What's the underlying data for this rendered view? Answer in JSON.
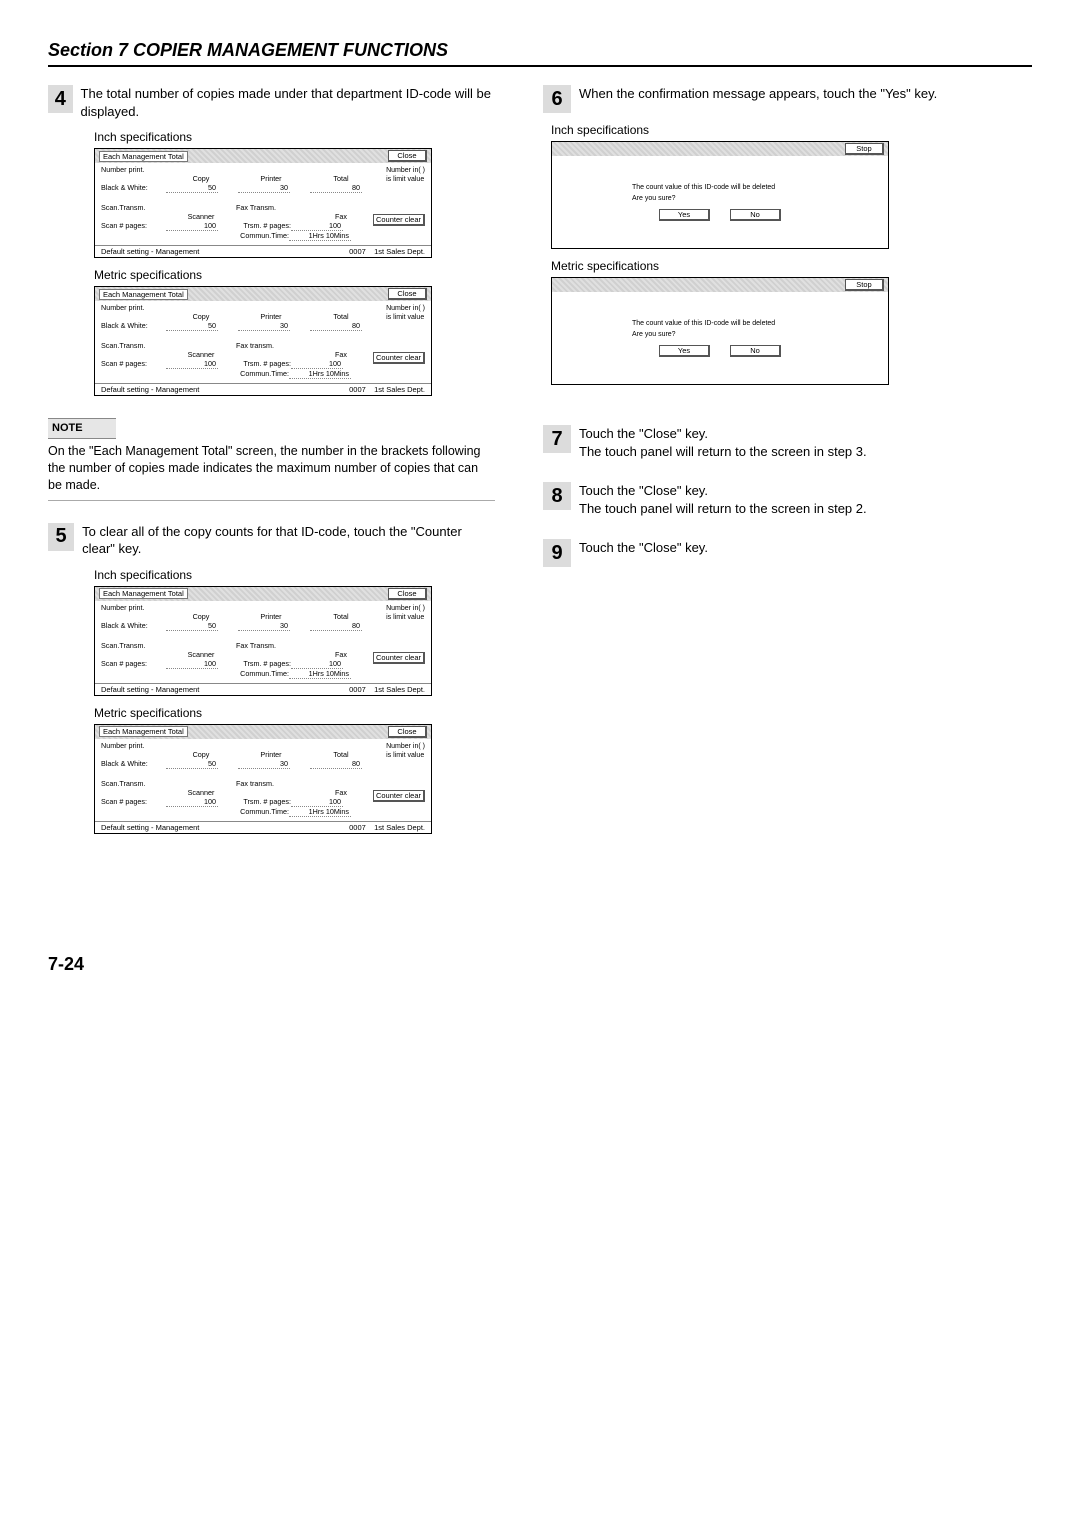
{
  "section_title": "Section 7  COPIER MANAGEMENT FUNCTIONS",
  "page_number": "7-24",
  "labels": {
    "inch_spec": "Inch specifications",
    "metric_spec": "Metric specifications",
    "note": "NOTE"
  },
  "steps": {
    "s4": "The total number of copies made under that department ID-code will be displayed.",
    "s5": "To clear all of the copy counts for that ID-code, touch the \"Counter clear\" key.",
    "s6": "When the confirmation message appears, touch the \"Yes\" key.",
    "s7a": "Touch the \"Close\" key.",
    "s7b": "The touch panel will return to the screen in step 3.",
    "s8a": "Touch the \"Close\" key.",
    "s8b": "The touch panel will return to the screen in step 2.",
    "s9": "Touch the \"Close\" key."
  },
  "note_text": "On the \"Each Management Total\" screen, the number in the brackets following the number of copies made indicates the maximum number of copies that can be made.",
  "screen1": {
    "tab": "Each Management Total",
    "close": "Close",
    "counter_clear": "Counter clear",
    "number_print": "Number print.",
    "copy": "Copy",
    "printer": "Printer",
    "total": "Total",
    "bw": "Black & White:",
    "v_copy": "50",
    "v_printer": "30",
    "v_total": "80",
    "right_top1": "Number in(  )",
    "right_top2": "is limit value",
    "scan_transm_inch": "Scan.Transm.",
    "scan_transm_metric": "Scan.Transm.",
    "fax_transm_inch": "Fax Transm.",
    "fax_transm_metric": "Fax transm.",
    "scanner": "Scanner",
    "fax": "Fax",
    "scan_pages": "Scan # pages:",
    "v_scan": "100",
    "trsm_pages": "Trsm. # pages:",
    "v_trsm": "100",
    "commun_time": "Commun.Time:",
    "v_time": "1Hrs 10Mins",
    "foot_left": "Default setting - Management",
    "foot_id": "0007",
    "foot_dept": "1st Sales Dept."
  },
  "confirm": {
    "stop": "Stop",
    "msg1": "The count value of this ID-code will be deleted",
    "msg2": "Are you sure?",
    "yes": "Yes",
    "no": "No"
  }
}
